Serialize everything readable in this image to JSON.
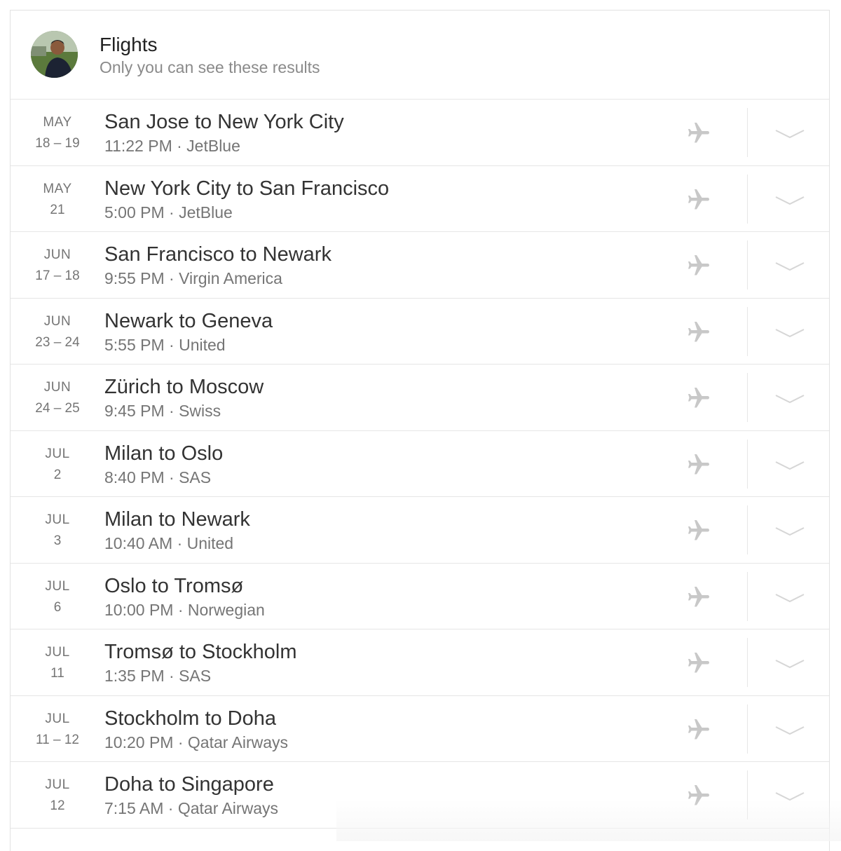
{
  "header": {
    "title": "Flights",
    "subtitle": "Only you can see these results",
    "avatar_icon": "user-avatar"
  },
  "colors": {
    "title_text": "#212121",
    "secondary_text": "#757575",
    "divider": "#e6e6e6",
    "icon": "#c8c8c8"
  },
  "icons": {
    "flight": "airplane-icon",
    "expand": "chevron-down-icon"
  },
  "flights": [
    {
      "month": "MAY",
      "days": "18 – 19",
      "route": "San Jose to New York City",
      "detail": "11:22 PM · JetBlue"
    },
    {
      "month": "MAY",
      "days": "21",
      "route": "New York City to San Francisco",
      "detail": "5:00 PM · JetBlue"
    },
    {
      "month": "JUN",
      "days": "17 – 18",
      "route": "San Francisco to Newark",
      "detail": "9:55 PM · Virgin America"
    },
    {
      "month": "JUN",
      "days": "23 – 24",
      "route": "Newark to Geneva",
      "detail": "5:55 PM · United"
    },
    {
      "month": "JUN",
      "days": "24 – 25",
      "route": "Zürich to Moscow",
      "detail": "9:45 PM · Swiss"
    },
    {
      "month": "JUL",
      "days": "2",
      "route": "Milan to Oslo",
      "detail": "8:40 PM · SAS"
    },
    {
      "month": "JUL",
      "days": "3",
      "route": "Milan to Newark",
      "detail": "10:40 AM · United"
    },
    {
      "month": "JUL",
      "days": "6",
      "route": "Oslo to Tromsø",
      "detail": "10:00 PM · Norwegian"
    },
    {
      "month": "JUL",
      "days": "11",
      "route": "Tromsø to Stockholm",
      "detail": "1:35 PM · SAS"
    },
    {
      "month": "JUL",
      "days": "11 – 12",
      "route": "Stockholm to Doha",
      "detail": "10:20 PM · Qatar Airways"
    },
    {
      "month": "JUL",
      "days": "12",
      "route": "Doha to Singapore",
      "detail": "7:15 AM · Qatar Airways"
    }
  ]
}
